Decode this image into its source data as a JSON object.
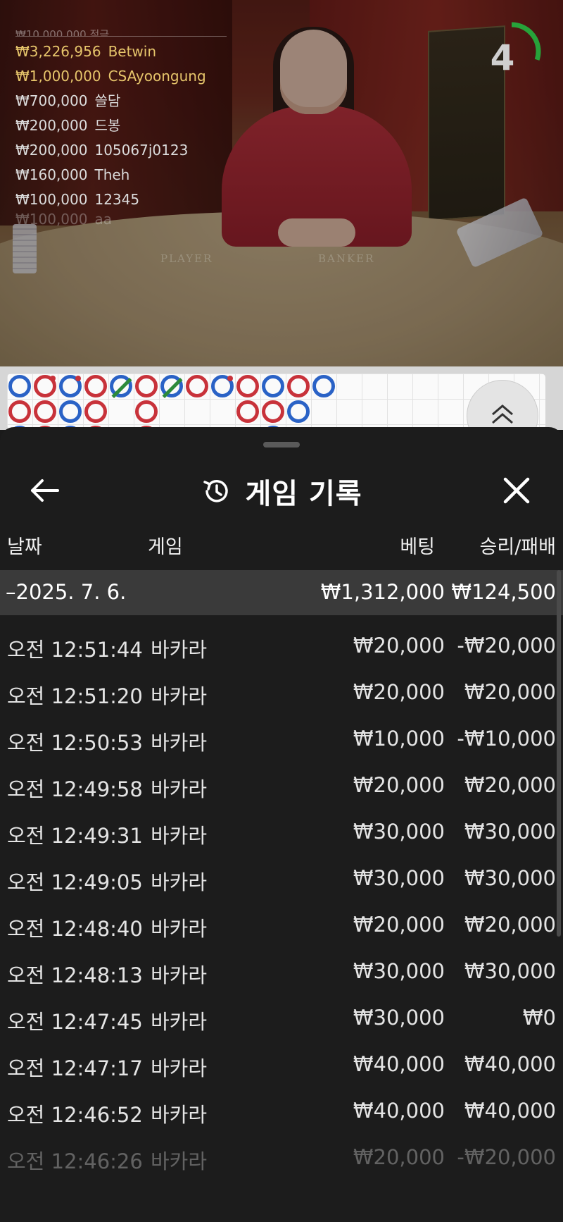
{
  "stream": {
    "bet_header": "₩10,000,000 적극",
    "bets": [
      {
        "amount": "₩3,226,956",
        "user": "Betwin",
        "style": "gold"
      },
      {
        "amount": "₩1,000,000",
        "user": "CSAyoongung",
        "style": "gold"
      },
      {
        "amount": "₩700,000",
        "user": "쓸담",
        "style": "white"
      },
      {
        "amount": "₩200,000",
        "user": "드봉",
        "style": "white"
      },
      {
        "amount": "₩200,000",
        "user": "105067j0123",
        "style": "white"
      },
      {
        "amount": "₩160,000",
        "user": "Theh",
        "style": "white"
      },
      {
        "amount": "₩100,000",
        "user": "12345",
        "style": "white"
      },
      {
        "amount": "₩100,000",
        "user": "aa",
        "style": "fade"
      }
    ],
    "timer_value": "4",
    "timer_fraction": 0.3,
    "timer_color": "#27a33a",
    "table_player_label": "PLAYER",
    "table_banker_label": "BANKER"
  },
  "bead_road": {
    "colors": {
      "banker": "#c8323a",
      "player": "#2a62c6",
      "tie": "#2d8a3a"
    },
    "columns": [
      [
        "P",
        "B",
        "P"
      ],
      [
        "B*",
        "B",
        "B"
      ],
      [
        "P*",
        "P",
        "P"
      ],
      [
        "B",
        "B",
        "B"
      ],
      [
        "P~",
        "",
        ""
      ],
      [
        "B",
        "B",
        "B"
      ],
      [
        "P~",
        "",
        ""
      ],
      [
        "B",
        "",
        ""
      ],
      [
        "P*",
        "",
        ""
      ],
      [
        "B",
        "B",
        ""
      ],
      [
        "P",
        "B",
        "P"
      ],
      [
        "B",
        "P",
        ""
      ],
      [
        "P",
        "",
        ""
      ]
    ],
    "expand_icon": "double-chevron-up-icon"
  },
  "history": {
    "title": "게임 기록",
    "title_icon": "history-icon",
    "back_icon": "arrow-left-icon",
    "close_icon": "close-icon",
    "columns": {
      "date": "날짜",
      "game": "게임",
      "bet": "베팅",
      "win_loss": "승리/패배"
    },
    "day": {
      "date": "–2025. 7. 6.",
      "bet": "₩1,312,000",
      "win_loss": "₩124,500"
    },
    "rows": [
      {
        "time": "오전 12:51:44",
        "game": "바카라",
        "bet": "₩20,000",
        "win_loss": "-₩20,000"
      },
      {
        "time": "오전 12:51:20",
        "game": "바카라",
        "bet": "₩20,000",
        "win_loss": "₩20,000"
      },
      {
        "time": "오전 12:50:53",
        "game": "바카라",
        "bet": "₩10,000",
        "win_loss": "-₩10,000"
      },
      {
        "time": "오전 12:49:58",
        "game": "바카라",
        "bet": "₩20,000",
        "win_loss": "₩20,000"
      },
      {
        "time": "오전 12:49:31",
        "game": "바카라",
        "bet": "₩30,000",
        "win_loss": "₩30,000"
      },
      {
        "time": "오전 12:49:05",
        "game": "바카라",
        "bet": "₩30,000",
        "win_loss": "₩30,000"
      },
      {
        "time": "오전 12:48:40",
        "game": "바카라",
        "bet": "₩20,000",
        "win_loss": "₩20,000"
      },
      {
        "time": "오전 12:48:13",
        "game": "바카라",
        "bet": "₩30,000",
        "win_loss": "₩30,000"
      },
      {
        "time": "오전 12:47:45",
        "game": "바카라",
        "bet": "₩30,000",
        "win_loss": "₩0"
      },
      {
        "time": "오전 12:47:17",
        "game": "바카라",
        "bet": "₩40,000",
        "win_loss": "₩40,000"
      },
      {
        "time": "오전 12:46:52",
        "game": "바카라",
        "bet": "₩40,000",
        "win_loss": "₩40,000"
      },
      {
        "time": "오전 12:46:26",
        "game": "바카라",
        "bet": "₩20,000",
        "win_loss": "-₩20,000"
      }
    ]
  }
}
